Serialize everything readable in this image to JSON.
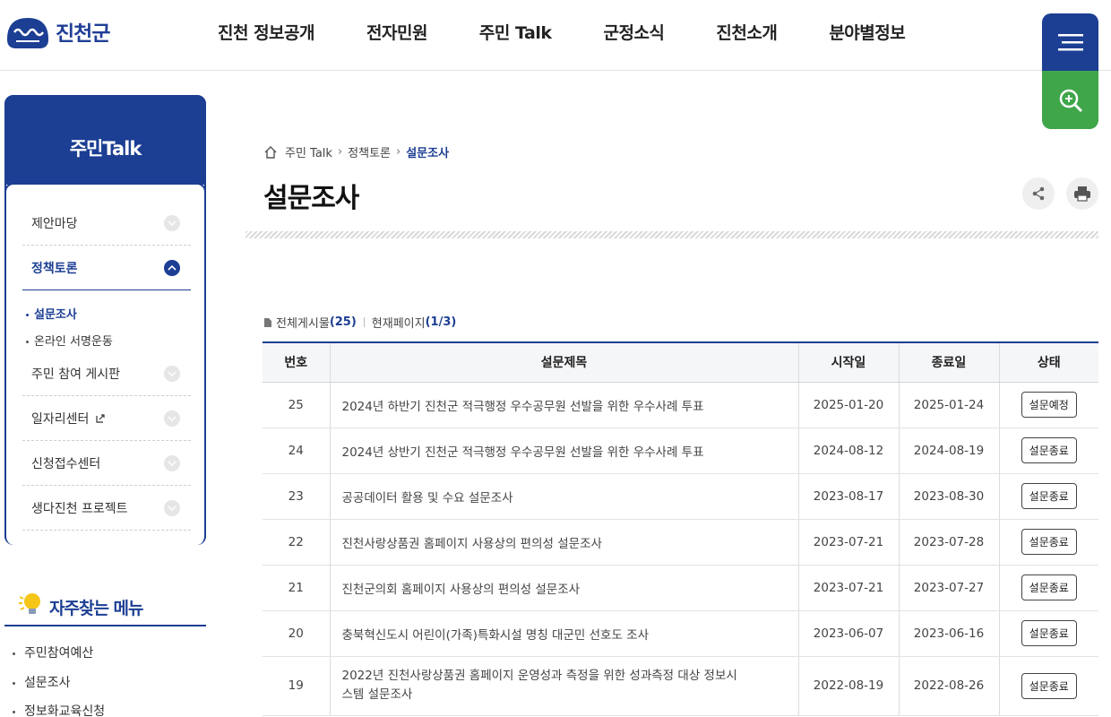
{
  "header": {
    "logo_text": "진천군",
    "nav": [
      "진천 정보공개",
      "전자민원",
      "주민 Talk",
      "군정소식",
      "진천소개",
      "분야별정보"
    ]
  },
  "sidebar": {
    "title": "주민Talk",
    "items": [
      {
        "label": "제안마당"
      },
      {
        "label": "정책토론"
      },
      {
        "label": "주민 참여 게시판"
      },
      {
        "label": "일자리센터"
      },
      {
        "label": "신청접수센터"
      },
      {
        "label": "생다진천 프로젝트"
      }
    ],
    "subitems": [
      "설문조사",
      "온라인 서명운동"
    ]
  },
  "favorites": {
    "title": "자주찾는 메뉴",
    "items": [
      "주민참여예산",
      "설문조사",
      "정보화교육신청"
    ]
  },
  "breadcrumb": {
    "level1": "주민 Talk",
    "level2": "정책토론",
    "current": "설문조사"
  },
  "page": {
    "title": "설문조사"
  },
  "board": {
    "total_label": "전체게시물",
    "total_count": "(25)",
    "page_label": "현재페이지",
    "page_value": "(1/3)",
    "columns": [
      "번호",
      "설문제목",
      "시작일",
      "종료일",
      "상태"
    ],
    "rows": [
      {
        "no": "25",
        "title": "2024년 하반기 진천군 적극행정 우수공무원 선발을 위한 우수사례 투표",
        "start": "2025-01-20",
        "end": "2025-01-24",
        "status": "설문예정"
      },
      {
        "no": "24",
        "title": "2024년 상반기 진천군 적극행정 우수공무원 선발을 위한 우수사례 투표",
        "start": "2024-08-12",
        "end": "2024-08-19",
        "status": "설문종료"
      },
      {
        "no": "23",
        "title": "공공데이터 활용 및 수요 설문조사",
        "start": "2023-08-17",
        "end": "2023-08-30",
        "status": "설문종료"
      },
      {
        "no": "22",
        "title": "진천사랑상품권 홈페이지 사용상의 편의성 설문조사",
        "start": "2023-07-21",
        "end": "2023-07-28",
        "status": "설문종료"
      },
      {
        "no": "21",
        "title": "진천군의회 홈페이지 사용상의 편의성 설문조사",
        "start": "2023-07-21",
        "end": "2023-07-27",
        "status": "설문종료"
      },
      {
        "no": "20",
        "title": "충북혁신도시 어린이(가족)특화시설 명칭 대군민 선호도 조사",
        "start": "2023-06-07",
        "end": "2023-06-16",
        "status": "설문종료"
      },
      {
        "no": "19",
        "title": "2022년 진천사랑상품권 홈페이지 운영성과 측정을 위한 성과측정 대상 정보시스템 설문조사",
        "start": "2022-08-19",
        "end": "2022-08-26",
        "status": "설문종료"
      }
    ]
  },
  "colors": {
    "primary": "#1c3e93",
    "search": "#3fa64a"
  },
  "icons": [
    "logo-icon",
    "menu-icon",
    "search-icon",
    "home-icon",
    "share-icon",
    "print-icon",
    "document-icon",
    "lightbulb-icon",
    "external-link-icon",
    "chevron-down-icon",
    "chevron-up-icon"
  ]
}
